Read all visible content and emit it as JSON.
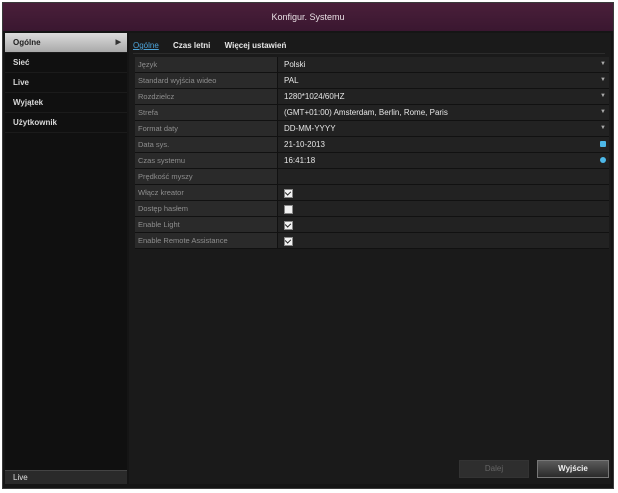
{
  "window": {
    "title": "Konfigur. Systemu"
  },
  "sidebar": {
    "items": [
      {
        "label": "Ogólne",
        "active": true
      },
      {
        "label": "Sieć"
      },
      {
        "label": "Live"
      },
      {
        "label": "Wyjątek"
      },
      {
        "label": "Użytkownik"
      }
    ],
    "footer": "Live"
  },
  "tabs": [
    {
      "label": "Ogólne",
      "active": true
    },
    {
      "label": "Czas letni"
    },
    {
      "label": "Więcej ustawień"
    }
  ],
  "settings": [
    {
      "label": "Język",
      "value": "Polski",
      "control": "dropdown"
    },
    {
      "label": "Standard wyjścia wideo",
      "value": "PAL",
      "control": "dropdown"
    },
    {
      "label": "Rozdzielcz",
      "value": "1280*1024/60HZ",
      "control": "dropdown"
    },
    {
      "label": "Strefa",
      "value": "(GMT+01:00) Amsterdam, Berlin, Rome, Paris",
      "control": "dropdown"
    },
    {
      "label": "Format daty",
      "value": "DD-MM-YYYY",
      "control": "dropdown"
    },
    {
      "label": "Data sys.",
      "value": "21-10-2013",
      "control": "calendar"
    },
    {
      "label": "Czas systemu",
      "value": "16:41:18",
      "control": "clock"
    },
    {
      "label": "Prędkość myszy",
      "value": "",
      "control": "slider"
    },
    {
      "label": "Włącz kreator",
      "checked": true,
      "control": "checkbox"
    },
    {
      "label": "Dostęp hasłem",
      "checked": false,
      "control": "checkbox"
    },
    {
      "label": "Enable Light",
      "checked": true,
      "control": "checkbox"
    },
    {
      "label": "Enable Remote Assistance",
      "checked": true,
      "control": "checkbox"
    }
  ],
  "buttons": {
    "save": "Dalej",
    "exit": "Wyjście"
  },
  "colors": {
    "title_bar": "#4a1f3a",
    "active_tab": "#4da3d8",
    "accent": "#4db8e8"
  }
}
